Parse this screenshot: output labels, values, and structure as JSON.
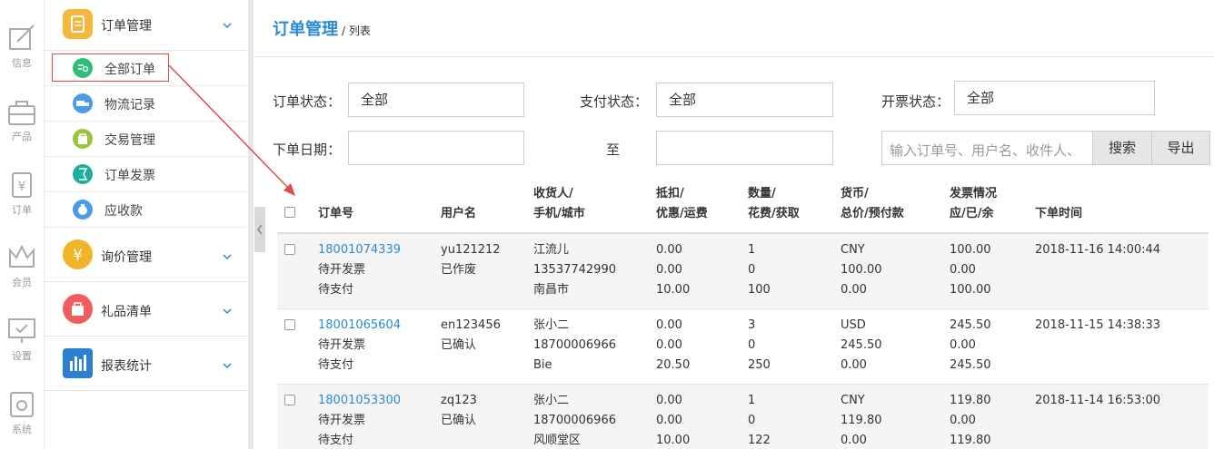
{
  "rail": [
    {
      "label": "信息",
      "icon": "info-edit-icon"
    },
    {
      "label": "产品",
      "icon": "product-bag-icon"
    },
    {
      "label": "订单",
      "icon": "order-yuan-icon"
    },
    {
      "label": "会员",
      "icon": "member-crown-icon"
    },
    {
      "label": "设置",
      "icon": "settings-monitor-icon"
    },
    {
      "label": "系统",
      "icon": "system-gear-icon"
    }
  ],
  "menu": {
    "order_mgmt": "订单管理",
    "sub_items": [
      "全部订单",
      "物流记录",
      "交易管理",
      "订单发票",
      "应收款"
    ],
    "inquiry": "询价管理",
    "gift": "礼品清单",
    "report": "报表统计"
  },
  "colors": {
    "accent": "#2b8ad6",
    "order_icon": "#f5b83d",
    "inquiry_icon": "#f0b429",
    "gift_icon": "#f25c5c",
    "report_icon": "#2b7fd0",
    "highlight": "#e24a4a"
  },
  "breadcrumb": {
    "title": "订单管理",
    "sub": "/ 列表"
  },
  "filters": {
    "order_status_label": "订单状态：",
    "order_status": "全部",
    "pay_status_label": "支付状态：",
    "pay_status": "全部",
    "invoice_status_label": "开票状态：",
    "invoice_status": "全部",
    "date_label": "下单日期：",
    "to_label": "至",
    "search_placeholder": "输入订单号、用户名、收件人、",
    "search_btn": "搜索",
    "export_btn": "导出"
  },
  "table": {
    "headers": {
      "order_no": "订单号",
      "user": "用户名",
      "receiver": [
        "收货人/",
        "手机/城市"
      ],
      "deduct": [
        "抵扣/",
        "优惠/运费"
      ],
      "qty": [
        "数量/",
        "花费/获取"
      ],
      "currency": [
        "货币/",
        "总价/预付款"
      ],
      "invoice": [
        "发票情况",
        "应/已/余"
      ],
      "time": "下单时间"
    },
    "rows": [
      {
        "order_no": "18001074339",
        "invoice_state": "待开发票",
        "pay_state": "待支付",
        "user": "yu121212",
        "user_state": "已作废",
        "receiver": [
          "江流儿",
          "13537742990",
          "南昌市"
        ],
        "deduct": [
          "0.00",
          "0.00",
          "10.00"
        ],
        "qty": [
          "1",
          "0",
          "100"
        ],
        "currency": [
          "CNY",
          "100.00",
          "0.00"
        ],
        "invoice": [
          "100.00",
          "0.00",
          "100.00"
        ],
        "time": "2018-11-16 14:00:44"
      },
      {
        "order_no": "18001065604",
        "invoice_state": "待开发票",
        "pay_state": "待支付",
        "user": "en123456",
        "user_state": "已确认",
        "receiver": [
          "张小二",
          "18700006966",
          "Bie"
        ],
        "deduct": [
          "0.00",
          "0.00",
          "20.50"
        ],
        "qty": [
          "3",
          "0",
          "250"
        ],
        "currency": [
          "USD",
          "245.50",
          "0.00"
        ],
        "invoice": [
          "245.50",
          "0.00",
          "245.50"
        ],
        "time": "2018-11-15 14:38:33"
      },
      {
        "order_no": "18001053300",
        "invoice_state": "待开发票",
        "pay_state": "待支付",
        "user": "zq123",
        "user_state": "已确认",
        "receiver": [
          "张小二",
          "18700006966",
          "风顺堂区"
        ],
        "deduct": [
          "0.00",
          "0.00",
          "10.00"
        ],
        "qty": [
          "1",
          "0",
          "122"
        ],
        "currency": [
          "CNY",
          "119.80",
          "0.00"
        ],
        "invoice": [
          "119.80",
          "0.00",
          "119.80"
        ],
        "time": "2018-11-14 16:53:00"
      }
    ]
  }
}
